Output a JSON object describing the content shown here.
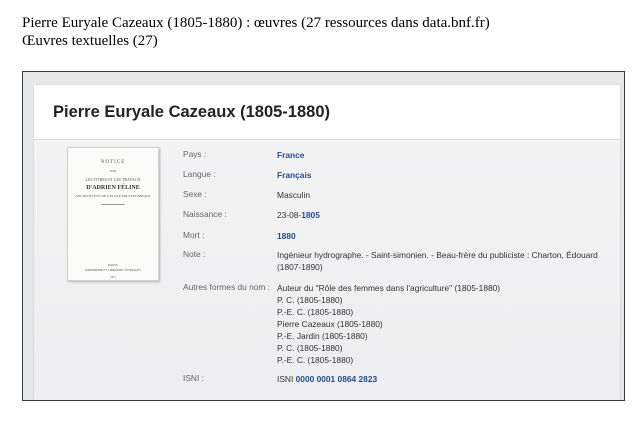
{
  "page_header": {
    "title": "Pierre Euryale Cazeaux (1805-1880) : œuvres (27 ressources  dans data.bnf.fr)",
    "subtitle": "Œuvres textuelles (27)"
  },
  "card": {
    "heading": "Pierre Euryale Cazeaux (1805-1880)",
    "cover": {
      "line1": "NOTICE",
      "line2": "SUR",
      "line3": "LES TITRES ET LES TRAVAUX",
      "line4": "D'ADRIEN FÉLINE",
      "line5": "ANCIEN ÉLÈVE DE L'ÉCOLE POLYTECHNIQUE",
      "line6": "PARIS",
      "line7": "IMPRIMERIE ET LIBRAIRIE CENTRALES",
      "line8": "1871"
    },
    "fields": {
      "pays": {
        "label": "Pays :",
        "value": "France"
      },
      "langue": {
        "label": "Langue :",
        "value": "Français"
      },
      "sexe": {
        "label": "Sexe :",
        "value": "Masculin"
      },
      "naissance": {
        "label": "Naissance :",
        "value_prefix": "23-08-",
        "value_link": "1805"
      },
      "mort": {
        "label": "Mort :",
        "value": "1880"
      },
      "note": {
        "label": "Note :",
        "line1": "Ingénieur hydrographe. - Saint-simonien. - Beau-frère du publiciste : Charton, Édouard",
        "line2": "(1807-1890)"
      },
      "autres": {
        "label": "Autres formes du nom :",
        "values": [
          "Auteur du \"Rôle des femmes dans l'agriculture\" (1805-1880)",
          "P. C. (1805-1880)",
          "P.-E. C. (1805-1880)",
          "Pierre Cazeaux (1805-1880)",
          "P.-E. Jardin (1805-1880)",
          "P. C. (1805-1880)",
          "P.-E. C. (1805-1880)"
        ]
      },
      "isni": {
        "label": "ISNI :",
        "value_prefix": "ISNI ",
        "value_link": "0000 0001 0864 2823"
      }
    }
  }
}
